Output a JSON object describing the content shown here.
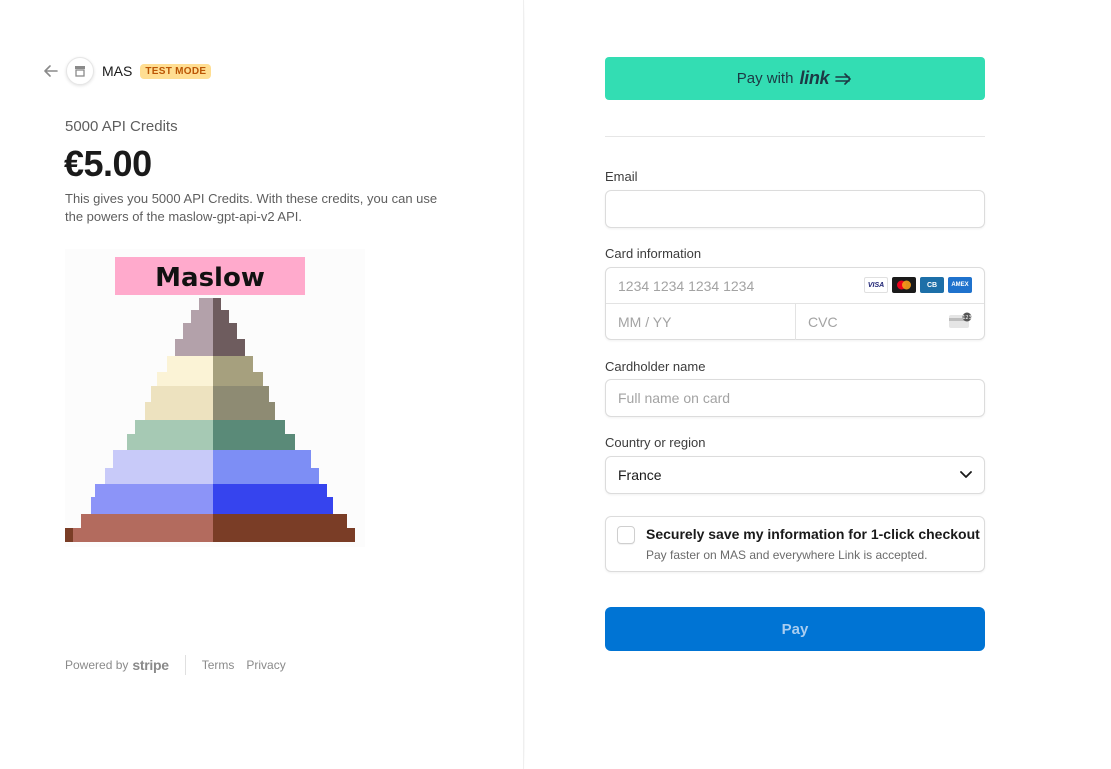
{
  "header": {
    "merchant_name": "MAS",
    "test_badge": "TEST MODE"
  },
  "product": {
    "name": "5000 API Credits",
    "price": "€5.00",
    "description": "This gives you 5000 API Credits. With these credits, you can use the powers of the maslow-gpt-api-v2 API.",
    "image_title": "Maslow"
  },
  "footer": {
    "powered_by": "Powered by",
    "stripe": "stripe",
    "terms": "Terms",
    "privacy": "Privacy"
  },
  "form": {
    "link_button_prefix": "Pay with",
    "link_word": "link",
    "email_label": "Email",
    "email_value": "",
    "card_label": "Card information",
    "card_number_placeholder": "1234 1234 1234 1234",
    "expiry_placeholder": "MM / YY",
    "cvc_placeholder": "CVC",
    "card_brands": [
      "VISA",
      "mastercard",
      "CB",
      "AMEX"
    ],
    "cardholder_label": "Cardholder name",
    "cardholder_placeholder": "Full name on card",
    "country_label": "Country or region",
    "country_value": "France",
    "save_title": "Securely save my information for 1-click checkout",
    "save_subtitle": "Pay faster on MAS and everywhere Link is accepted.",
    "pay_label": "Pay"
  },
  "colors": {
    "link_green": "#33ddb3",
    "pay_blue": "#0074d4",
    "test_badge_bg": "#ffde92",
    "image_title_bg": "#ffaacc"
  }
}
